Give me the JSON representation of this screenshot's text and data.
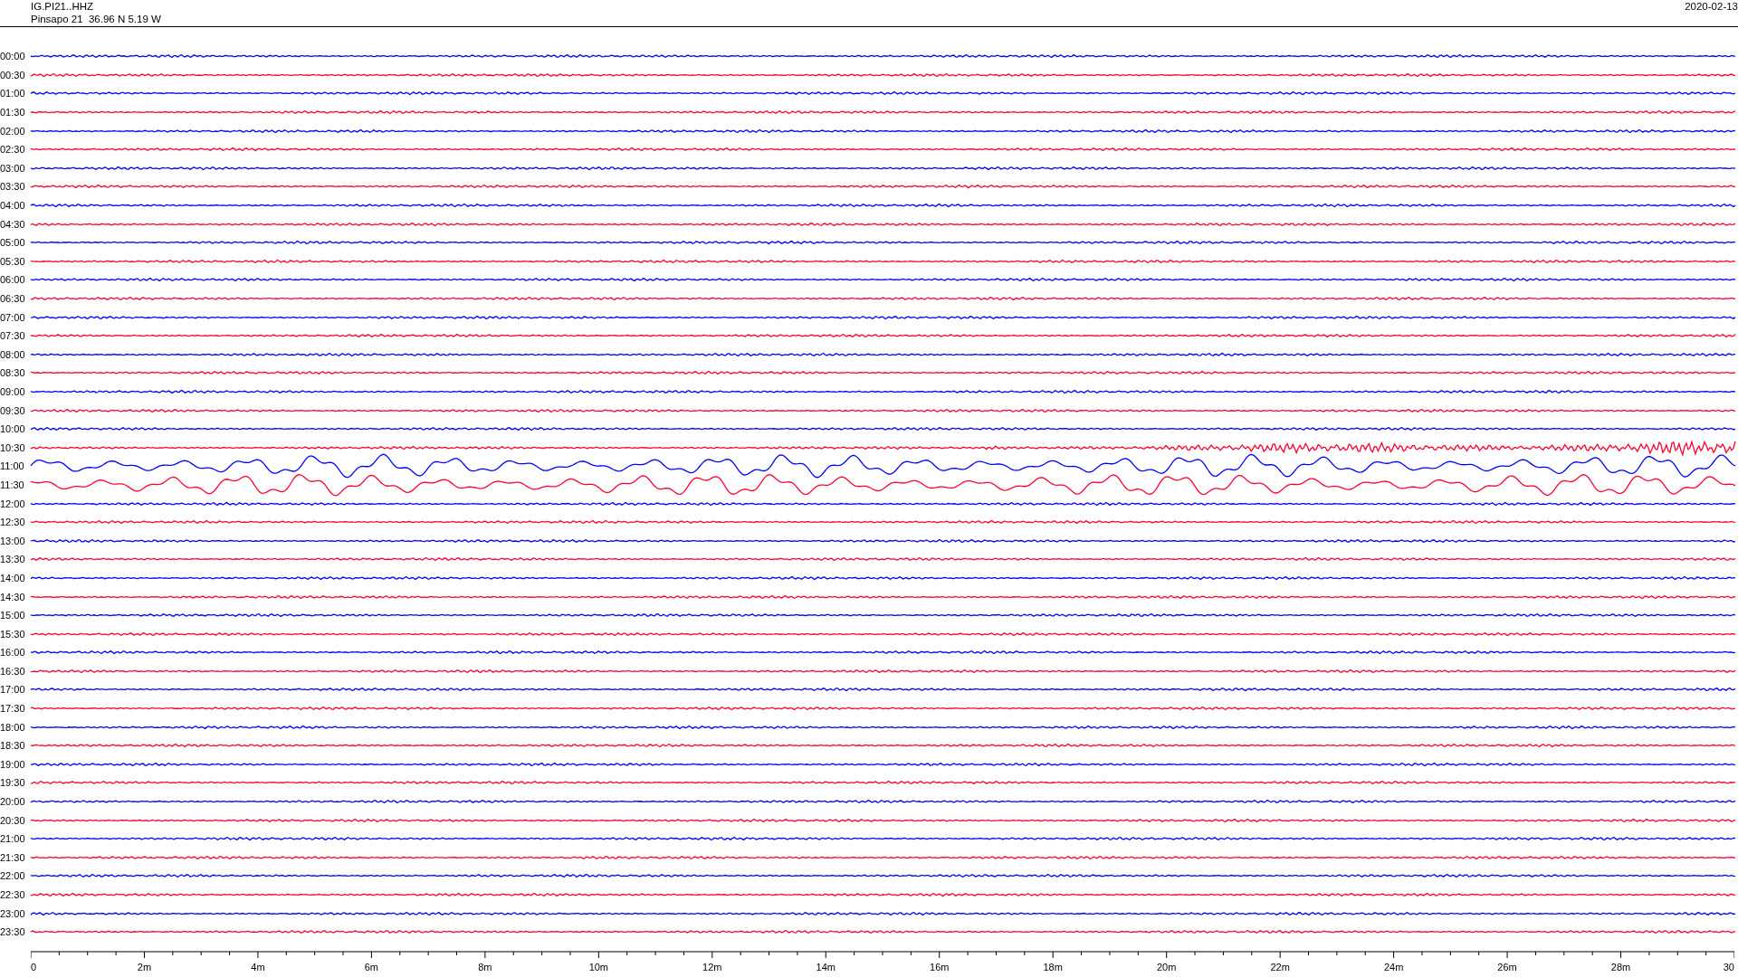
{
  "header": {
    "channel": "IG.PI21..HHZ",
    "station": "Pinsapo 21  36.96 N 5.19 W",
    "date": "2020-02-13"
  },
  "rows": [
    {
      "time": "00:00",
      "color": "#0000ff",
      "kind": "quiet"
    },
    {
      "time": "00:30",
      "color": "#ff0033",
      "kind": "quiet"
    },
    {
      "time": "01:00",
      "color": "#0000ff",
      "kind": "quiet"
    },
    {
      "time": "01:30",
      "color": "#ff0033",
      "kind": "quiet"
    },
    {
      "time": "02:00",
      "color": "#0000ff",
      "kind": "quiet"
    },
    {
      "time": "02:30",
      "color": "#ff0033",
      "kind": "quiet"
    },
    {
      "time": "03:00",
      "color": "#0000ff",
      "kind": "quiet"
    },
    {
      "time": "03:30",
      "color": "#ff0033",
      "kind": "quiet"
    },
    {
      "time": "04:00",
      "color": "#0000ff",
      "kind": "quiet"
    },
    {
      "time": "04:30",
      "color": "#ff0033",
      "kind": "quiet"
    },
    {
      "time": "05:00",
      "color": "#0000ff",
      "kind": "quiet"
    },
    {
      "time": "05:30",
      "color": "#ff0033",
      "kind": "quiet"
    },
    {
      "time": "06:00",
      "color": "#0000ff",
      "kind": "quiet"
    },
    {
      "time": "06:30",
      "color": "#ff0033",
      "kind": "quiet"
    },
    {
      "time": "07:00",
      "color": "#0000ff",
      "kind": "quiet"
    },
    {
      "time": "07:30",
      "color": "#ff0033",
      "kind": "quiet"
    },
    {
      "time": "08:00",
      "color": "#0000ff",
      "kind": "quiet"
    },
    {
      "time": "08:30",
      "color": "#ff0033",
      "kind": "quiet"
    },
    {
      "time": "09:00",
      "color": "#0000ff",
      "kind": "quiet"
    },
    {
      "time": "09:30",
      "color": "#ff0033",
      "kind": "quiet"
    },
    {
      "time": "10:00",
      "color": "#0000ff",
      "kind": "quiet"
    },
    {
      "time": "10:30",
      "color": "#ff0033",
      "kind": "rising"
    },
    {
      "time": "11:00",
      "color": "#0000ff",
      "kind": "storm"
    },
    {
      "time": "11:30",
      "color": "#ff0033",
      "kind": "storm"
    },
    {
      "time": "12:00",
      "color": "#0000ff",
      "kind": "quiet"
    },
    {
      "time": "12:30",
      "color": "#ff0033",
      "kind": "quiet"
    },
    {
      "time": "13:00",
      "color": "#0000ff",
      "kind": "quiet"
    },
    {
      "time": "13:30",
      "color": "#ff0033",
      "kind": "quiet"
    },
    {
      "time": "14:00",
      "color": "#0000ff",
      "kind": "quiet"
    },
    {
      "time": "14:30",
      "color": "#ff0033",
      "kind": "quiet"
    },
    {
      "time": "15:00",
      "color": "#0000ff",
      "kind": "quiet"
    },
    {
      "time": "15:30",
      "color": "#ff0033",
      "kind": "quiet"
    },
    {
      "time": "16:00",
      "color": "#0000ff",
      "kind": "quiet"
    },
    {
      "time": "16:30",
      "color": "#ff0033",
      "kind": "quiet"
    },
    {
      "time": "17:00",
      "color": "#0000ff",
      "kind": "quiet"
    },
    {
      "time": "17:30",
      "color": "#ff0033",
      "kind": "quiet"
    },
    {
      "time": "18:00",
      "color": "#0000ff",
      "kind": "quiet"
    },
    {
      "time": "18:30",
      "color": "#ff0033",
      "kind": "quiet"
    },
    {
      "time": "19:00",
      "color": "#0000ff",
      "kind": "quiet"
    },
    {
      "time": "19:30",
      "color": "#ff0033",
      "kind": "quiet"
    },
    {
      "time": "20:00",
      "color": "#0000ff",
      "kind": "quiet"
    },
    {
      "time": "20:30",
      "color": "#ff0033",
      "kind": "quiet"
    },
    {
      "time": "21:00",
      "color": "#0000ff",
      "kind": "quiet"
    },
    {
      "time": "21:30",
      "color": "#ff0033",
      "kind": "quiet"
    },
    {
      "time": "22:00",
      "color": "#0000ff",
      "kind": "quiet"
    },
    {
      "time": "22:30",
      "color": "#ff0033",
      "kind": "quiet"
    },
    {
      "time": "23:00",
      "color": "#0000ff",
      "kind": "quiet"
    },
    {
      "time": "23:30",
      "color": "#ff0033",
      "kind": "quiet"
    }
  ],
  "x_axis": {
    "labels": [
      "0",
      "2m",
      "4m",
      "6m",
      "8m",
      "10m",
      "12m",
      "14m",
      "16m",
      "18m",
      "20m",
      "22m",
      "24m",
      "26m",
      "28m",
      "30"
    ]
  }
}
